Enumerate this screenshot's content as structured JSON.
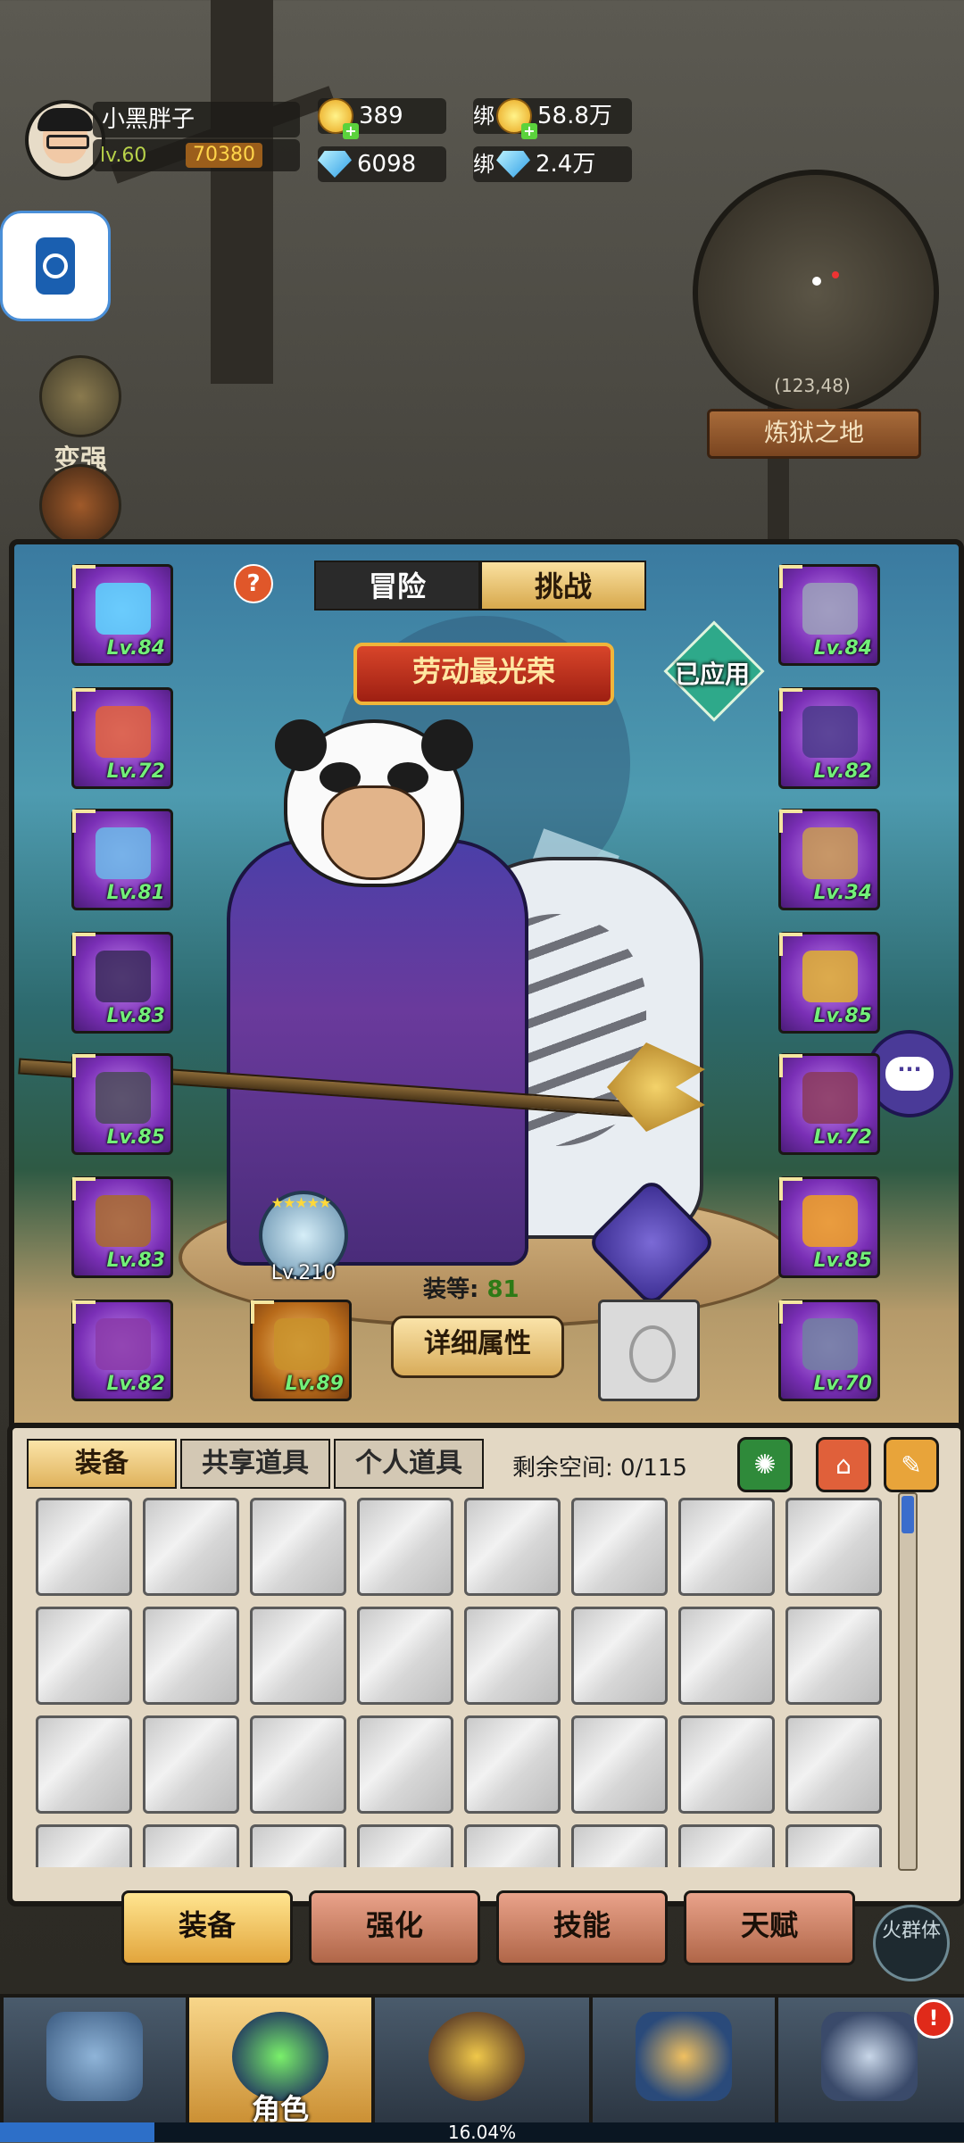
{
  "player": {
    "name": "小黑胖子",
    "level": "lv.60",
    "power": "70380"
  },
  "currency": {
    "gold": "389",
    "gems": "6098",
    "bound_gold_tag": "绑",
    "bound_gold": "58.8万",
    "bound_gems_tag": "绑",
    "bound_gems": "2.4万"
  },
  "map": {
    "coords": "(123,48)",
    "name": "炼狱之地"
  },
  "side": {
    "strengthen": "变强"
  },
  "panel": {
    "tab_adventure": "冒险",
    "tab_challenge": "挑战",
    "help": "?",
    "title": "劳动最光荣",
    "applied": "已应用",
    "pet_level": "Lv.210",
    "pet_stars": "★★★★★",
    "gear_score_label": "装等:",
    "gear_score": "81",
    "detail_button": "详细属性",
    "chat_icon": "···"
  },
  "left_slots": [
    {
      "level": "Lv.84",
      "color": "#5ad7ff"
    },
    {
      "level": "Lv.72",
      "color": "#e0603a"
    },
    {
      "level": "Lv.81",
      "color": "#6ab8e8"
    },
    {
      "level": "Lv.83",
      "color": "#3a2a5a"
    },
    {
      "level": "Lv.85",
      "color": "#4a4a58"
    },
    {
      "level": "Lv.83",
      "color": "#a86a2a"
    },
    {
      "level": "Lv.82",
      "color": "#8a3aa8"
    }
  ],
  "right_slots": [
    {
      "level": "Lv.84",
      "color": "#9aa0b8"
    },
    {
      "level": "Lv.82",
      "color": "#4a3a8a"
    },
    {
      "level": "Lv.34",
      "color": "#c89a50"
    },
    {
      "level": "Lv.85",
      "color": "#e0b030"
    },
    {
      "level": "Lv.72",
      "color": "#8a3a5a"
    },
    {
      "level": "Lv.85",
      "color": "#f0a020"
    },
    {
      "level": "Lv.70",
      "color": "#7080a0"
    }
  ],
  "weapon_slot": {
    "level": "Lv.89",
    "color": "#c8902a"
  },
  "inventory": {
    "tab_equipment": "装备",
    "tab_shared": "共享道具",
    "tab_personal": "个人道具",
    "space": "剩余空间: 0/115"
  },
  "subnav": {
    "equip": "装备",
    "enhance": "强化",
    "skills": "技能",
    "talent": "天赋",
    "fire_group": "火群体"
  },
  "bottom_nav": {
    "character": "角色",
    "badge": "!"
  },
  "loading": {
    "text": "16.04%",
    "progress": 0.1604
  }
}
